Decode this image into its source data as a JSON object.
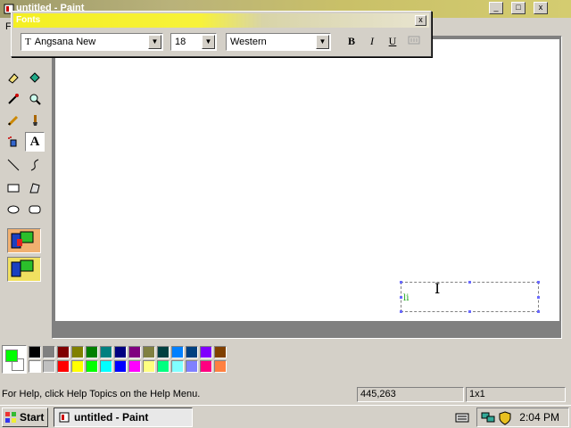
{
  "window": {
    "title": "untitled - Paint"
  },
  "menubar": {
    "items": [
      "F"
    ]
  },
  "fonts_toolbar": {
    "title": "Fonts",
    "font_name": "Angsana New",
    "font_size": "18",
    "script": "Western",
    "bold_label": "B",
    "italic_label": "I",
    "underline_label": "U"
  },
  "canvas": {
    "typed_text": "li"
  },
  "status": {
    "help_text": "For Help, click Help Topics on the Help Menu.",
    "coords": "445,263",
    "size": "1x1"
  },
  "taskbar": {
    "start_label": "Start",
    "task_label": "untitled - Paint",
    "clock": "2:04 PM"
  },
  "palette": {
    "foreground": "#00ff00",
    "background": "#ffffff",
    "row1": [
      "#000000",
      "#808080",
      "#800000",
      "#808000",
      "#008000",
      "#008080",
      "#000080",
      "#800080",
      "#808040",
      "#004040",
      "#0080ff",
      "#004080",
      "#8000ff",
      "#804000"
    ],
    "row2": [
      "#ffffff",
      "#c0c0c0",
      "#ff0000",
      "#ffff00",
      "#00ff00",
      "#00ffff",
      "#0000ff",
      "#ff00ff",
      "#ffff80",
      "#00ff80",
      "#80ffff",
      "#8080ff",
      "#ff0080",
      "#ff8040"
    ]
  }
}
